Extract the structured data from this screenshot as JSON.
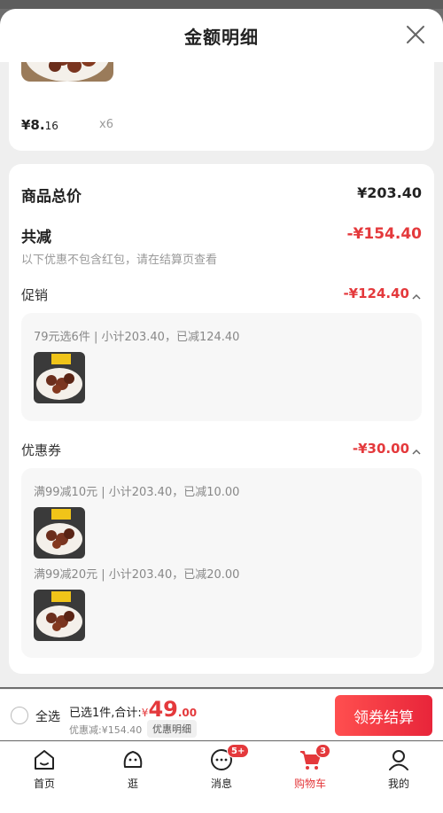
{
  "sheet": {
    "title": "金额明细"
  },
  "product": {
    "price_main": "¥8.",
    "price_cents": "16",
    "qty": "x6"
  },
  "totals": {
    "goods_total_label": "商品总价",
    "goods_total_value": "¥203.40",
    "reduce_label": "共减",
    "reduce_value": "-¥154.40",
    "hint": "以下优惠不包含红包，请在结算页查看"
  },
  "promotion": {
    "label": "促销",
    "amount": "-¥124.40",
    "line": "79元选6件 | 小计203.40，已减124.40"
  },
  "coupon": {
    "label": "优惠券",
    "amount": "-¥30.00",
    "line1": "满99减10元 | 小计203.40，已减10.00",
    "line2": "满99减20元 | 小计203.40，已减20.00"
  },
  "bottom_bar": {
    "select_all": "全选",
    "selected_text": "已选1件,合计:",
    "yen": "¥",
    "total_int": "49",
    "total_dec": ".00",
    "discount_text": "优惠减:¥154.40",
    "detail_chip": "优惠明细",
    "checkout_label": "领券结算"
  },
  "tabs": [
    {
      "label": "首页",
      "icon": "home-icon"
    },
    {
      "label": "逛",
      "icon": "browse-icon"
    },
    {
      "label": "消息",
      "icon": "message-icon",
      "badge": "5+"
    },
    {
      "label": "购物车",
      "icon": "cart-icon",
      "badge": "3"
    },
    {
      "label": "我的",
      "icon": "profile-icon"
    }
  ],
  "colors": {
    "accent": "#e4393c",
    "background": "#efefef"
  }
}
